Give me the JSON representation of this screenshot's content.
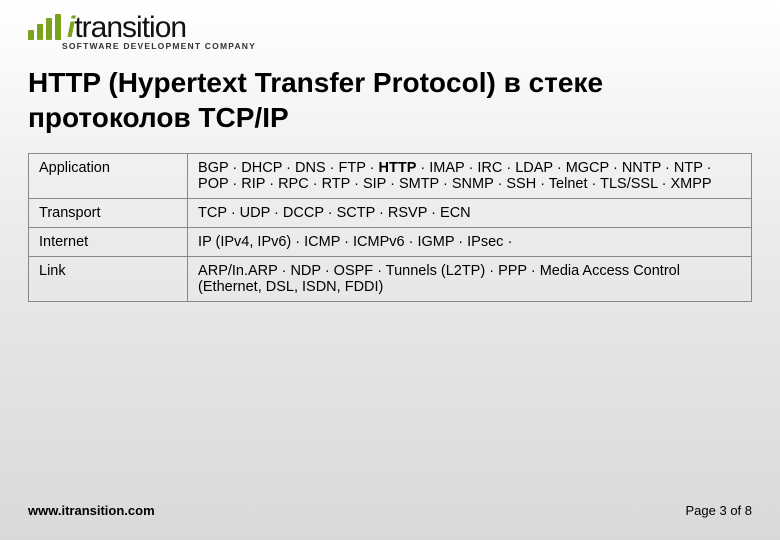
{
  "brand": {
    "name_prefix": "i",
    "name_rest": "transition",
    "tagline": "SOFTWARE DEVELOPMENT COMPANY"
  },
  "title": "HTTP (Hypertext Transfer Protocol) в стеке протоколов TCP/IP",
  "table": {
    "rows": [
      {
        "layer": "Application",
        "protocols": "BGP · DHCP · DNS · FTP · HTTP · IMAP · IRC · LDAP · MGCP · NNTP · NTP · POP · RIP · RPC · RTP · SIP · SMTP · SNMP · SSH · Telnet · TLS/SSL · XMPP",
        "bold": [
          "HTTP"
        ]
      },
      {
        "layer": "Transport",
        "protocols": "TCP · UDP · DCCP · SCTP · RSVP · ECN",
        "bold": []
      },
      {
        "layer": "Internet",
        "protocols": "IP (IPv4, IPv6) · ICMP · ICMPv6 · IGMP · IPsec ·",
        "bold": []
      },
      {
        "layer": "Link",
        "protocols": "ARP/In.ARP · NDP · OSPF · Tunnels (L2TP) · PPP · Media Access Control (Ethernet, DSL, ISDN, FDDI)",
        "bold": []
      }
    ]
  },
  "footer": {
    "url": "www.itransition.com",
    "page": "Page 3 of 8"
  }
}
